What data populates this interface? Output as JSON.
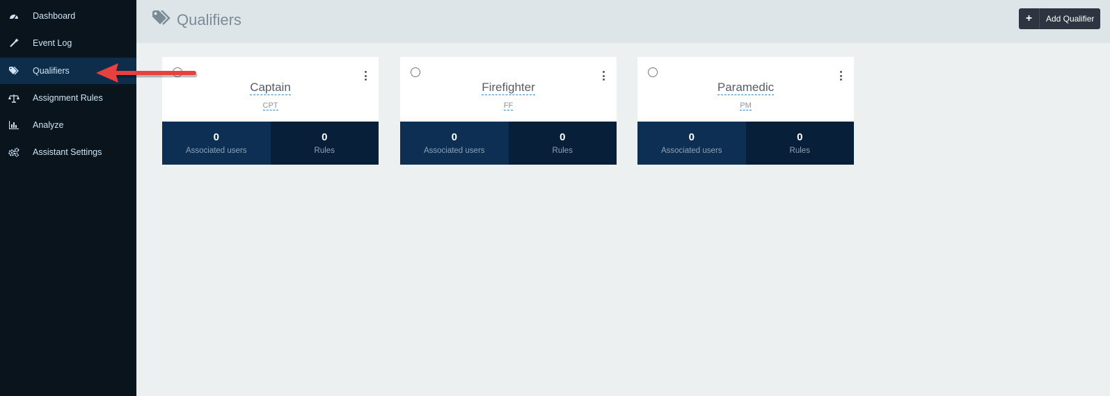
{
  "sidebar": {
    "items": [
      {
        "label": "Dashboard",
        "icon": "dashboard-icon"
      },
      {
        "label": "Event Log",
        "icon": "wand-icon"
      },
      {
        "label": "Qualifiers",
        "icon": "tags-icon",
        "active": true
      },
      {
        "label": "Assignment Rules",
        "icon": "balance-scale-icon"
      },
      {
        "label": "Analyze",
        "icon": "bar-chart-icon"
      },
      {
        "label": "Assistant Settings",
        "icon": "gears-icon"
      }
    ]
  },
  "header": {
    "title": "Qualifiers",
    "add_button_label": "Add Qualifier",
    "add_button_icon": "+"
  },
  "qualifiers": [
    {
      "name": "Captain",
      "code": "CPT",
      "users": "0",
      "users_label": "Associated users",
      "rules": "0",
      "rules_label": "Rules"
    },
    {
      "name": "Firefighter",
      "code": "FF",
      "users": "0",
      "users_label": "Associated users",
      "rules": "0",
      "rules_label": "Rules"
    },
    {
      "name": "Paramedic",
      "code": "PM",
      "users": "0",
      "users_label": "Associated users",
      "rules": "0",
      "rules_label": "Rules"
    }
  ],
  "colors": {
    "sidebar_bg": "#0a141c",
    "sidebar_active": "#0d2d4b",
    "header_bg": "#dee5e9",
    "stat_users_bg": "#0d2f53",
    "stat_rules_bg": "#071f39",
    "annotation_arrow": "#e8413d"
  }
}
